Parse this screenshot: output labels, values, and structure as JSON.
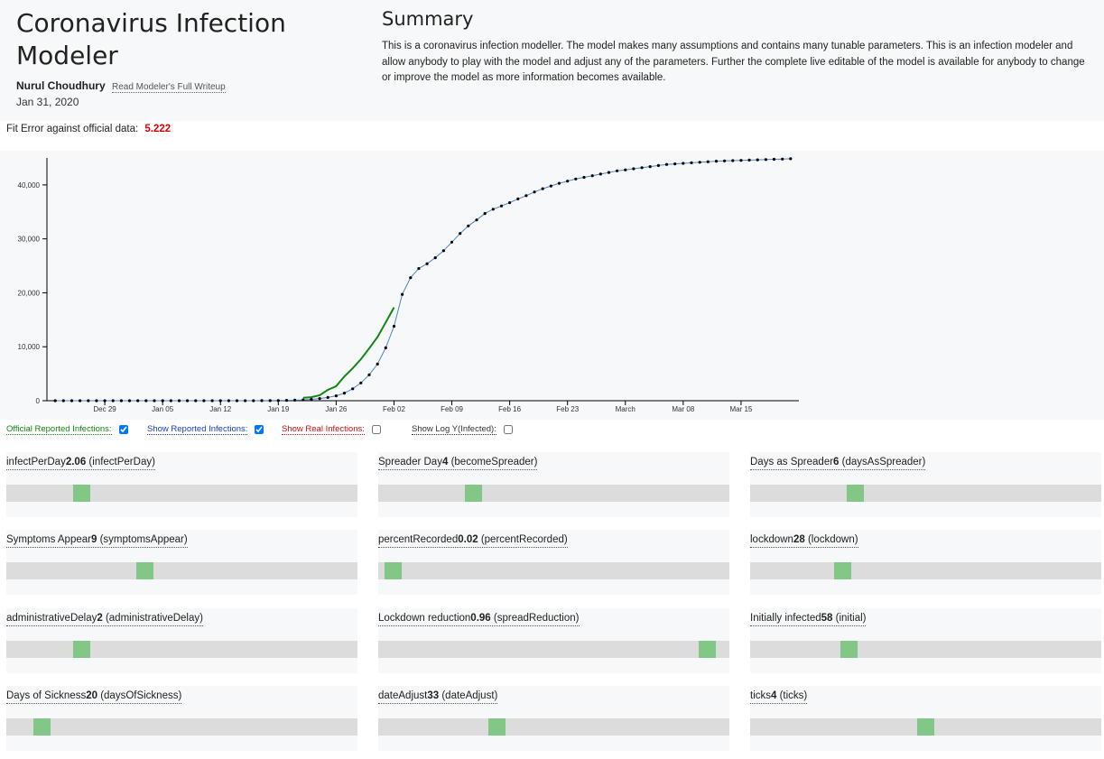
{
  "header": {
    "title": "Coronavirus Infection Modeler",
    "author": "Nurul Choudhury",
    "writeup_link": "Read Modeler's Full Writeup",
    "date": "Jan 31, 2020",
    "summary_title": "Summary",
    "summary_text": "This is a coronavirus infection modeller. The model makes many assumptions and contains many tunable parameters. This is an infection modeler and allow anybody to play with the model and adjust any of the parameters. Further the complete live editable of the model is available for anybody to change or improve the model as more information becomes available."
  },
  "fit": {
    "label": "Fit Error against official data:",
    "value": "5.222"
  },
  "chart_data": {
    "type": "line",
    "xlabel": "",
    "ylabel": "",
    "x_ticks": [
      "Dec 29",
      "Jan 05",
      "Jan 12",
      "Jan 19",
      "Jan 26",
      "Feb 02",
      "Feb 09",
      "Feb 16",
      "Feb 23",
      "March",
      "Mar 08",
      "Mar 15"
    ],
    "y_ticks": [
      "0",
      "10,000",
      "20,000",
      "30,000",
      "40,000"
    ],
    "ylim": [
      0,
      45000
    ],
    "xlim": [
      "Dec 22",
      "Mar 22"
    ],
    "grid": false,
    "series": [
      {
        "color": "#4a86c8",
        "marker": "dot",
        "start_date": "Dec 23",
        "step_days": 1,
        "values": [
          0,
          0,
          0,
          0,
          0,
          0,
          0,
          0,
          0,
          0,
          0,
          0,
          0,
          0,
          0,
          0,
          0,
          0,
          0,
          0,
          0,
          0,
          0,
          0,
          0,
          10,
          20,
          40,
          60,
          100,
          150,
          250,
          400,
          600,
          900,
          1400,
          2200,
          3300,
          4800,
          6800,
          9800,
          13800,
          19700,
          22800,
          24500,
          25400,
          26500,
          27800,
          29400,
          31000,
          32400,
          33500,
          34700,
          35500,
          36100,
          36700,
          37400,
          38000,
          38700,
          39300,
          39800,
          40300,
          40700,
          41100,
          41400,
          41700,
          42000,
          42300,
          42600,
          42800,
          43000,
          43200,
          43400,
          43600,
          43800,
          43900,
          44000,
          44100,
          44200,
          44300,
          44400,
          44450,
          44500,
          44550,
          44600,
          44650,
          44700,
          44750,
          44800,
          44850
        ]
      },
      {
        "color": "#118811",
        "marker": "none",
        "dates": [
          "Jan 22",
          "Jan 23",
          "Jan 24",
          "Jan 25",
          "Jan 26",
          "Jan 27",
          "Jan 28",
          "Jan 29",
          "Jan 30",
          "Jan 31",
          "Feb 01",
          "Feb 02"
        ],
        "values": [
          550,
          650,
          1000,
          2000,
          2700,
          4500,
          6000,
          7700,
          9700,
          11800,
          14500,
          17300
        ]
      }
    ]
  },
  "toggles": [
    {
      "label": "Official Reported Infections:",
      "checked": true,
      "color": "#118811"
    },
    {
      "label": "Show Reported Infections:",
      "checked": true,
      "color": "#1a3cc8"
    },
    {
      "label": "Show Real Infections:",
      "checked": false,
      "color": "#d01010"
    },
    {
      "label": "Show Log Y(Infected):",
      "checked": false,
      "color": "#333333"
    }
  ],
  "params": [
    {
      "name": "infectPerDay",
      "value": "2.06",
      "key": "(infectPerDay)",
      "level": 0.2
    },
    {
      "name": "Spreader Day",
      "value": "4",
      "key": "(becomeSpreader)",
      "level": 0.26
    },
    {
      "name": "Days as Spreader",
      "value": "6",
      "key": "(daysAsSpreader)",
      "level": 0.29
    },
    {
      "name": "Symptoms Appear",
      "value": "9",
      "key": "(symptomsAppear)",
      "level": 0.39
    },
    {
      "name": "percentRecorded",
      "value": "0.02",
      "key": "(percentRecorded)",
      "level": 0.02
    },
    {
      "name": "lockdown",
      "value": "28",
      "key": "(lockdown)",
      "level": 0.25
    },
    {
      "name": "administrativeDelay",
      "value": "2",
      "key": "(administrativeDelay)",
      "level": 0.2
    },
    {
      "name": "Lockdown reduction",
      "value": "0.96",
      "key": "(spreadReduction)",
      "level": 0.96
    },
    {
      "name": "Initially infected",
      "value": "58",
      "key": "(initial)",
      "level": 0.27
    },
    {
      "name": "Days of Sickness",
      "value": "20",
      "key": "(daysOfSickness)",
      "level": 0.08
    },
    {
      "name": "dateAdjust",
      "value": "33",
      "key": "(dateAdjust)",
      "level": 0.33
    },
    {
      "name": "ticks",
      "value": "4",
      "key": "(ticks)",
      "level": 0.5
    }
  ]
}
